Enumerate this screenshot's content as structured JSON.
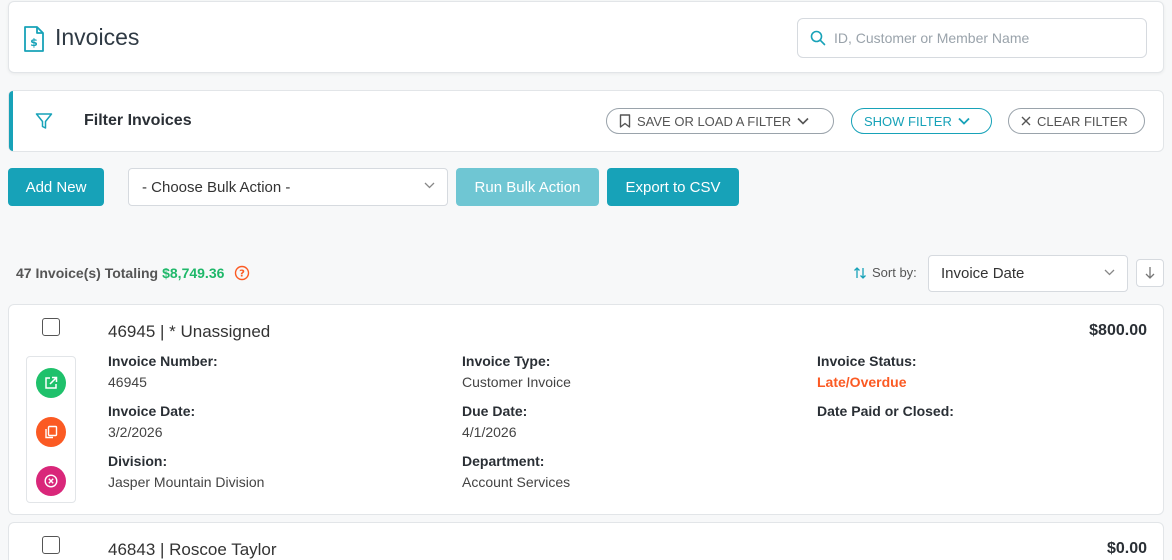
{
  "header": {
    "title": "Invoices",
    "search_placeholder": "ID, Customer or Member Name"
  },
  "filter": {
    "title": "Filter Invoices",
    "save_load_label": "SAVE OR LOAD A FILTER",
    "show_label": "SHOW FILTER",
    "clear_label": "CLEAR FILTER"
  },
  "toolbar": {
    "add_new_label": "Add New",
    "bulk_action_selected": "- Choose Bulk Action -",
    "run_bulk_label": "Run Bulk Action",
    "export_label": "Export to CSV"
  },
  "summary": {
    "count_text": "47 Invoice(s) Totaling",
    "total": "$8,749.36",
    "sort_label": "Sort by:",
    "sort_selected": "Invoice Date"
  },
  "colors": {
    "accent": "#17a2b8",
    "total_green": "#1fb86a",
    "late_orange": "#fb5a23",
    "open_green": "#1fc16b",
    "delete_pink": "#d9277a"
  },
  "invoices": [
    {
      "title": "46945 | * Unassigned",
      "amount": "$800.00",
      "fields": {
        "invoice_number_label": "Invoice Number:",
        "invoice_number": "46945",
        "invoice_type_label": "Invoice Type:",
        "invoice_type": "Customer Invoice",
        "status_label": "Invoice Status:",
        "status": "Late/Overdue",
        "invoice_date_label": "Invoice Date:",
        "invoice_date": "3/2/2026",
        "due_date_label": "Due Date:",
        "due_date": "4/1/2026",
        "date_paid_label": "Date Paid or Closed:",
        "division_label": "Division:",
        "division": "Jasper Mountain Division",
        "department_label": "Department:",
        "department": "Account Services"
      }
    },
    {
      "title": "46843 | Roscoe Taylor",
      "amount": "$0.00"
    }
  ]
}
